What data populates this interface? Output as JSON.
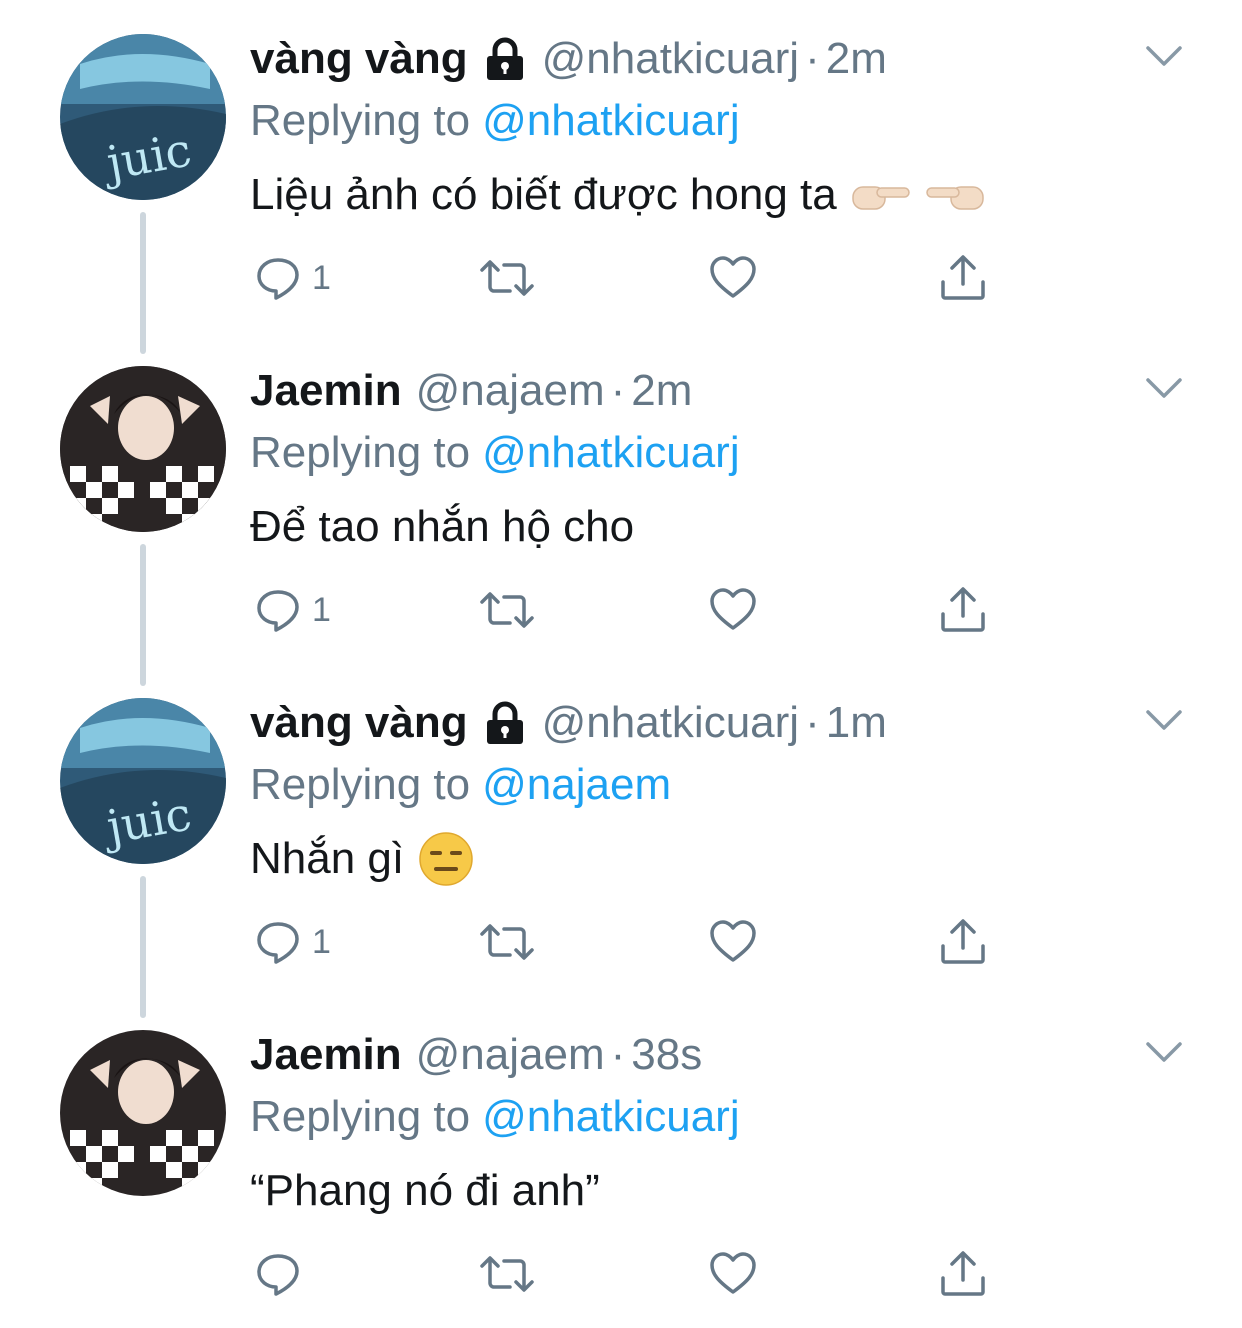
{
  "colors": {
    "accent": "#1da1f2",
    "secondary_text": "#657786",
    "thread_line": "#cdd6dd"
  },
  "tweets": [
    {
      "name": "vàng vàng",
      "locked": true,
      "handle": "@nhatkicuarj",
      "dot": "·",
      "time": "2m",
      "reply_prefix": "Replying to",
      "reply_target": "@nhatkicuarj",
      "text": "Liệu ảnh có biết được hong ta",
      "emojis": [
        "pointing-right-emoji",
        "pointing-left-emoji"
      ],
      "reply_count": "1",
      "avatar_caption": "juic"
    },
    {
      "name": "Jaemin",
      "locked": false,
      "handle": "@najaem",
      "dot": "·",
      "time": "2m",
      "reply_prefix": "Replying to",
      "reply_target": "@nhatkicuarj",
      "text": "Để tao nhắn hộ cho",
      "emojis": [],
      "reply_count": "1"
    },
    {
      "name": "vàng vàng",
      "locked": true,
      "handle": "@nhatkicuarj",
      "dot": "·",
      "time": "1m",
      "reply_prefix": "Replying to",
      "reply_target": "@najaem",
      "text": "Nhắn gì",
      "emojis": [
        "expressionless-face-emoji"
      ],
      "reply_count": "1",
      "avatar_caption": "juic"
    },
    {
      "name": "Jaemin",
      "locked": false,
      "handle": "@najaem",
      "dot": "·",
      "time": "38s",
      "reply_prefix": "Replying to",
      "reply_target": "@nhatkicuarj",
      "text": "“Phang nó đi anh”",
      "emojis": [],
      "reply_count": ""
    }
  ]
}
